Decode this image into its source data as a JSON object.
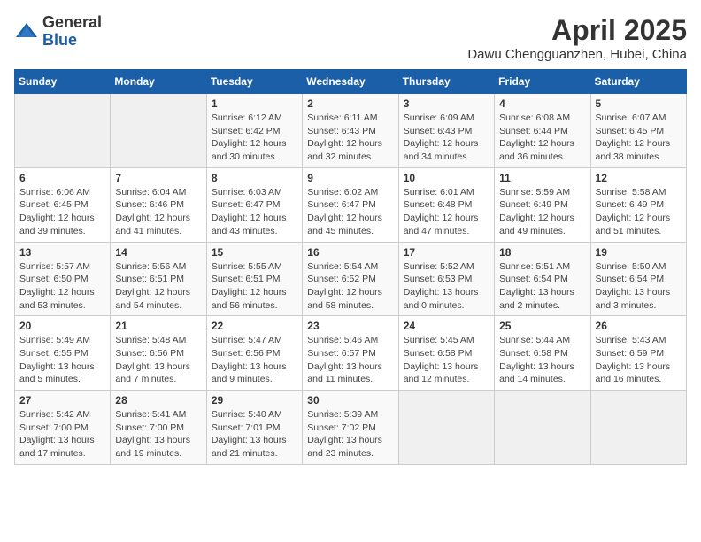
{
  "header": {
    "logo_general": "General",
    "logo_blue": "Blue",
    "title": "April 2025",
    "location": "Dawu Chengguanzhen, Hubei, China"
  },
  "weekdays": [
    "Sunday",
    "Monday",
    "Tuesday",
    "Wednesday",
    "Thursday",
    "Friday",
    "Saturday"
  ],
  "weeks": [
    [
      {
        "day": "",
        "info": ""
      },
      {
        "day": "",
        "info": ""
      },
      {
        "day": "1",
        "info": "Sunrise: 6:12 AM\nSunset: 6:42 PM\nDaylight: 12 hours\nand 30 minutes."
      },
      {
        "day": "2",
        "info": "Sunrise: 6:11 AM\nSunset: 6:43 PM\nDaylight: 12 hours\nand 32 minutes."
      },
      {
        "day": "3",
        "info": "Sunrise: 6:09 AM\nSunset: 6:43 PM\nDaylight: 12 hours\nand 34 minutes."
      },
      {
        "day": "4",
        "info": "Sunrise: 6:08 AM\nSunset: 6:44 PM\nDaylight: 12 hours\nand 36 minutes."
      },
      {
        "day": "5",
        "info": "Sunrise: 6:07 AM\nSunset: 6:45 PM\nDaylight: 12 hours\nand 38 minutes."
      }
    ],
    [
      {
        "day": "6",
        "info": "Sunrise: 6:06 AM\nSunset: 6:45 PM\nDaylight: 12 hours\nand 39 minutes."
      },
      {
        "day": "7",
        "info": "Sunrise: 6:04 AM\nSunset: 6:46 PM\nDaylight: 12 hours\nand 41 minutes."
      },
      {
        "day": "8",
        "info": "Sunrise: 6:03 AM\nSunset: 6:47 PM\nDaylight: 12 hours\nand 43 minutes."
      },
      {
        "day": "9",
        "info": "Sunrise: 6:02 AM\nSunset: 6:47 PM\nDaylight: 12 hours\nand 45 minutes."
      },
      {
        "day": "10",
        "info": "Sunrise: 6:01 AM\nSunset: 6:48 PM\nDaylight: 12 hours\nand 47 minutes."
      },
      {
        "day": "11",
        "info": "Sunrise: 5:59 AM\nSunset: 6:49 PM\nDaylight: 12 hours\nand 49 minutes."
      },
      {
        "day": "12",
        "info": "Sunrise: 5:58 AM\nSunset: 6:49 PM\nDaylight: 12 hours\nand 51 minutes."
      }
    ],
    [
      {
        "day": "13",
        "info": "Sunrise: 5:57 AM\nSunset: 6:50 PM\nDaylight: 12 hours\nand 53 minutes."
      },
      {
        "day": "14",
        "info": "Sunrise: 5:56 AM\nSunset: 6:51 PM\nDaylight: 12 hours\nand 54 minutes."
      },
      {
        "day": "15",
        "info": "Sunrise: 5:55 AM\nSunset: 6:51 PM\nDaylight: 12 hours\nand 56 minutes."
      },
      {
        "day": "16",
        "info": "Sunrise: 5:54 AM\nSunset: 6:52 PM\nDaylight: 12 hours\nand 58 minutes."
      },
      {
        "day": "17",
        "info": "Sunrise: 5:52 AM\nSunset: 6:53 PM\nDaylight: 13 hours\nand 0 minutes."
      },
      {
        "day": "18",
        "info": "Sunrise: 5:51 AM\nSunset: 6:54 PM\nDaylight: 13 hours\nand 2 minutes."
      },
      {
        "day": "19",
        "info": "Sunrise: 5:50 AM\nSunset: 6:54 PM\nDaylight: 13 hours\nand 3 minutes."
      }
    ],
    [
      {
        "day": "20",
        "info": "Sunrise: 5:49 AM\nSunset: 6:55 PM\nDaylight: 13 hours\nand 5 minutes."
      },
      {
        "day": "21",
        "info": "Sunrise: 5:48 AM\nSunset: 6:56 PM\nDaylight: 13 hours\nand 7 minutes."
      },
      {
        "day": "22",
        "info": "Sunrise: 5:47 AM\nSunset: 6:56 PM\nDaylight: 13 hours\nand 9 minutes."
      },
      {
        "day": "23",
        "info": "Sunrise: 5:46 AM\nSunset: 6:57 PM\nDaylight: 13 hours\nand 11 minutes."
      },
      {
        "day": "24",
        "info": "Sunrise: 5:45 AM\nSunset: 6:58 PM\nDaylight: 13 hours\nand 12 minutes."
      },
      {
        "day": "25",
        "info": "Sunrise: 5:44 AM\nSunset: 6:58 PM\nDaylight: 13 hours\nand 14 minutes."
      },
      {
        "day": "26",
        "info": "Sunrise: 5:43 AM\nSunset: 6:59 PM\nDaylight: 13 hours\nand 16 minutes."
      }
    ],
    [
      {
        "day": "27",
        "info": "Sunrise: 5:42 AM\nSunset: 7:00 PM\nDaylight: 13 hours\nand 17 minutes."
      },
      {
        "day": "28",
        "info": "Sunrise: 5:41 AM\nSunset: 7:00 PM\nDaylight: 13 hours\nand 19 minutes."
      },
      {
        "day": "29",
        "info": "Sunrise: 5:40 AM\nSunset: 7:01 PM\nDaylight: 13 hours\nand 21 minutes."
      },
      {
        "day": "30",
        "info": "Sunrise: 5:39 AM\nSunset: 7:02 PM\nDaylight: 13 hours\nand 23 minutes."
      },
      {
        "day": "",
        "info": ""
      },
      {
        "day": "",
        "info": ""
      },
      {
        "day": "",
        "info": ""
      }
    ]
  ]
}
